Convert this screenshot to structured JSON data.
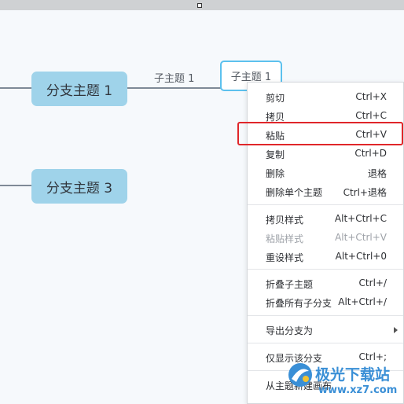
{
  "canvas": {
    "branches": [
      {
        "label": "分支主题 1"
      },
      {
        "label": "分支主题 3"
      }
    ],
    "subtopics": [
      {
        "label": "子主题 1"
      },
      {
        "label": "子主题 1"
      }
    ]
  },
  "context_menu": {
    "items": [
      {
        "label": "剪切",
        "shortcut": "Ctrl+X"
      },
      {
        "label": "拷贝",
        "shortcut": "Ctrl+C"
      },
      {
        "label": "粘贴",
        "shortcut": "Ctrl+V"
      },
      {
        "label": "复制",
        "shortcut": "Ctrl+D"
      },
      {
        "label": "删除",
        "shortcut": "退格"
      },
      {
        "label": "删除单个主题",
        "shortcut": "Ctrl+退格"
      },
      {
        "label": "拷贝样式",
        "shortcut": "Alt+Ctrl+C"
      },
      {
        "label": "粘贴样式",
        "shortcut": "Alt+Ctrl+V"
      },
      {
        "label": "重设样式",
        "shortcut": "Alt+Ctrl+0"
      },
      {
        "label": "折叠子主题",
        "shortcut": "Ctrl+/"
      },
      {
        "label": "折叠所有子分支",
        "shortcut": "Alt+Ctrl+/"
      },
      {
        "label": "导出分支为",
        "shortcut": ""
      },
      {
        "label": "仅显示该分支",
        "shortcut": "Ctrl+;"
      },
      {
        "label": "从主题新建画布",
        "shortcut": ""
      }
    ]
  },
  "watermark": {
    "title": "极光下载站",
    "url": "www.xz7.com"
  },
  "colors": {
    "branch_fill": "#9fd3ea",
    "selection_border": "#5cc1ee",
    "highlight_border": "#e0262a",
    "canvas_bg": "#f6f9fc"
  }
}
